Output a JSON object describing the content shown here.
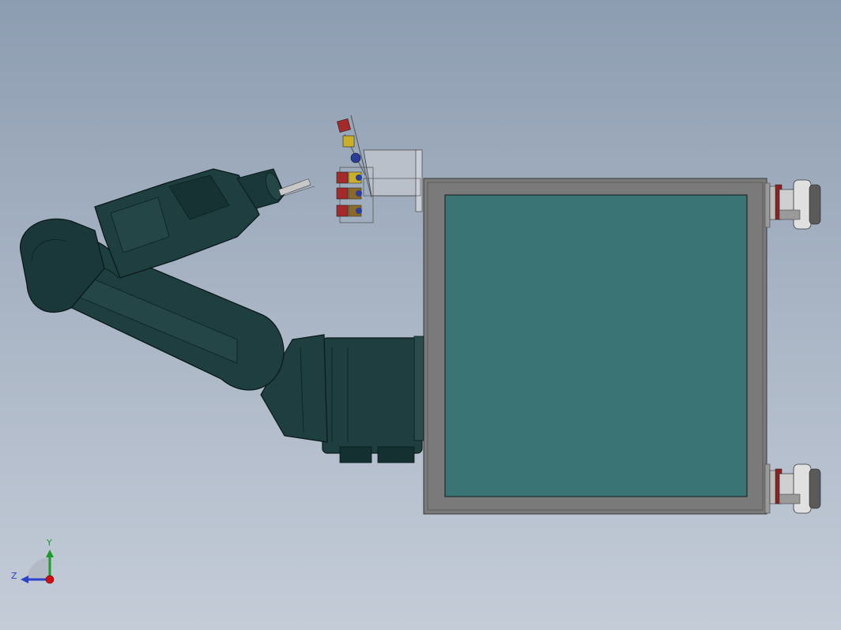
{
  "viewport": {
    "background_top": "#8d9db1",
    "background_bottom": "#c4ccd8"
  },
  "model": {
    "robot_color": "#1e3e3f",
    "robot_dark": "#102626",
    "frame_color": "#7a7a7a",
    "panel_color": "#3a7475",
    "wheel_color": "#d8d8d8",
    "tool_red": "#a52a2a",
    "tool_yellow": "#c8b02a",
    "tool_blue": "#2a3d9a"
  },
  "triad": {
    "x_label": "",
    "y_label": "Y",
    "z_label": "Z",
    "y_color": "#1c9a2a",
    "z_color": "#2a44c8",
    "origin_color": "#d01010"
  }
}
